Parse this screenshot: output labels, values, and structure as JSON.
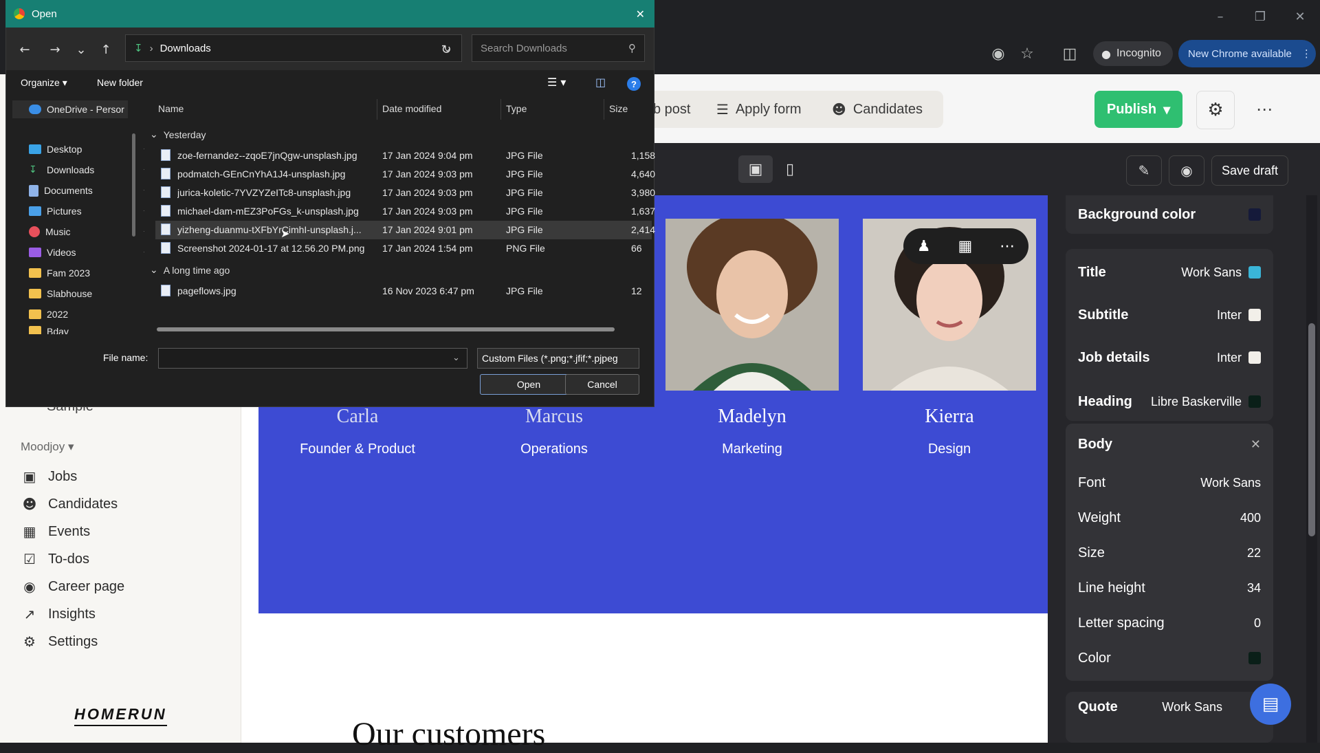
{
  "chrome": {
    "incognito_label": "Incognito",
    "new_chrome_label": "New Chrome available"
  },
  "app": {
    "tabs": [
      "b post",
      "Apply form",
      "Candidates"
    ],
    "publish_label": "Publish",
    "save_draft_label": "Save draft",
    "sidebar": {
      "sample_label": "Sample",
      "workspace": "Moodjoy",
      "items": [
        "Jobs",
        "Candidates",
        "Events",
        "To-dos",
        "Career page",
        "Insights",
        "Settings"
      ],
      "logo": "HOMERUN"
    },
    "team": [
      {
        "name": "Carla",
        "role": "Founder & Product"
      },
      {
        "name": "Marcus",
        "role": "Operations"
      },
      {
        "name": "Madelyn",
        "role": "Marketing"
      },
      {
        "name": "Kierra",
        "role": "Design"
      }
    ],
    "customers_heading": "Our customers"
  },
  "panel": {
    "background_color_label": "Background color",
    "fonts": [
      {
        "label": "Title",
        "font": "Work Sans",
        "color": "#3ab5d8"
      },
      {
        "label": "Subtitle",
        "font": "Inter",
        "color": "#f2efe9"
      },
      {
        "label": "Job details",
        "font": "Inter",
        "color": "#f2efe9"
      },
      {
        "label": "Heading",
        "font": "Libre Baskerville",
        "color": "#0a1f18"
      }
    ],
    "body": {
      "label": "Body",
      "rows": [
        {
          "label": "Font",
          "value": "Work Sans"
        },
        {
          "label": "Weight",
          "value": "400"
        },
        {
          "label": "Size",
          "value": "22"
        },
        {
          "label": "Line height",
          "value": "34"
        },
        {
          "label": "Letter spacing",
          "value": "0"
        },
        {
          "label": "Color",
          "value": ""
        }
      ]
    },
    "quote": {
      "label": "Quote",
      "font": "Work Sans"
    }
  },
  "dialog": {
    "title": "Open",
    "path": "Downloads",
    "search_placeholder": "Search Downloads",
    "organize_label": "Organize",
    "new_folder_label": "New folder",
    "nav": [
      {
        "label": "OneDrive - Persor",
        "icon": "cloud-icon"
      },
      {
        "label": "Desktop",
        "icon": "desktop-icon"
      },
      {
        "label": "Downloads",
        "icon": "download-icon"
      },
      {
        "label": "Documents",
        "icon": "documents-icon"
      },
      {
        "label": "Pictures",
        "icon": "pictures-icon"
      },
      {
        "label": "Music",
        "icon": "music-icon"
      },
      {
        "label": "Videos",
        "icon": "videos-icon"
      },
      {
        "label": "Fam 2023",
        "icon": "folder-icon"
      },
      {
        "label": "Slabhouse",
        "icon": "folder-icon"
      },
      {
        "label": "2022",
        "icon": "folder-icon"
      },
      {
        "label": "Bday",
        "icon": "folder-icon"
      }
    ],
    "columns": [
      "Name",
      "Date modified",
      "Type",
      "Size"
    ],
    "groups": [
      {
        "label": "Yesterday",
        "files": [
          {
            "name": "zoe-fernandez--zqoE7jnQgw-unsplash.jpg",
            "date": "17 Jan 2024 9:04 pm",
            "type": "JPG File",
            "size": "1,158"
          },
          {
            "name": "podmatch-GEnCnYhA1J4-unsplash.jpg",
            "date": "17 Jan 2024 9:03 pm",
            "type": "JPG File",
            "size": "4,640"
          },
          {
            "name": "jurica-koletic-7YVZYZeITc8-unsplash.jpg",
            "date": "17 Jan 2024 9:03 pm",
            "type": "JPG File",
            "size": "3,980"
          },
          {
            "name": "michael-dam-mEZ3PoFGs_k-unsplash.jpg",
            "date": "17 Jan 2024 9:03 pm",
            "type": "JPG File",
            "size": "1,637"
          },
          {
            "name": "yizheng-duanmu-tXFbYrCimhI-unsplash.j...",
            "date": "17 Jan 2024 9:01 pm",
            "type": "JPG File",
            "size": "2,414"
          },
          {
            "name": "Screenshot 2024-01-17 at 12.56.20 PM.png",
            "date": "17 Jan 2024 1:54 pm",
            "type": "PNG File",
            "size": "66"
          }
        ]
      },
      {
        "label": "A long time ago",
        "files": [
          {
            "name": "pageflows.jpg",
            "date": "16 Nov 2023 6:47 pm",
            "type": "JPG File",
            "size": "12"
          }
        ]
      }
    ],
    "file_name_label": "File name:",
    "file_name_value": "",
    "file_type": "Custom Files (*.png;*.jfif;*.pjpeg",
    "open_label": "Open",
    "cancel_label": "Cancel"
  }
}
